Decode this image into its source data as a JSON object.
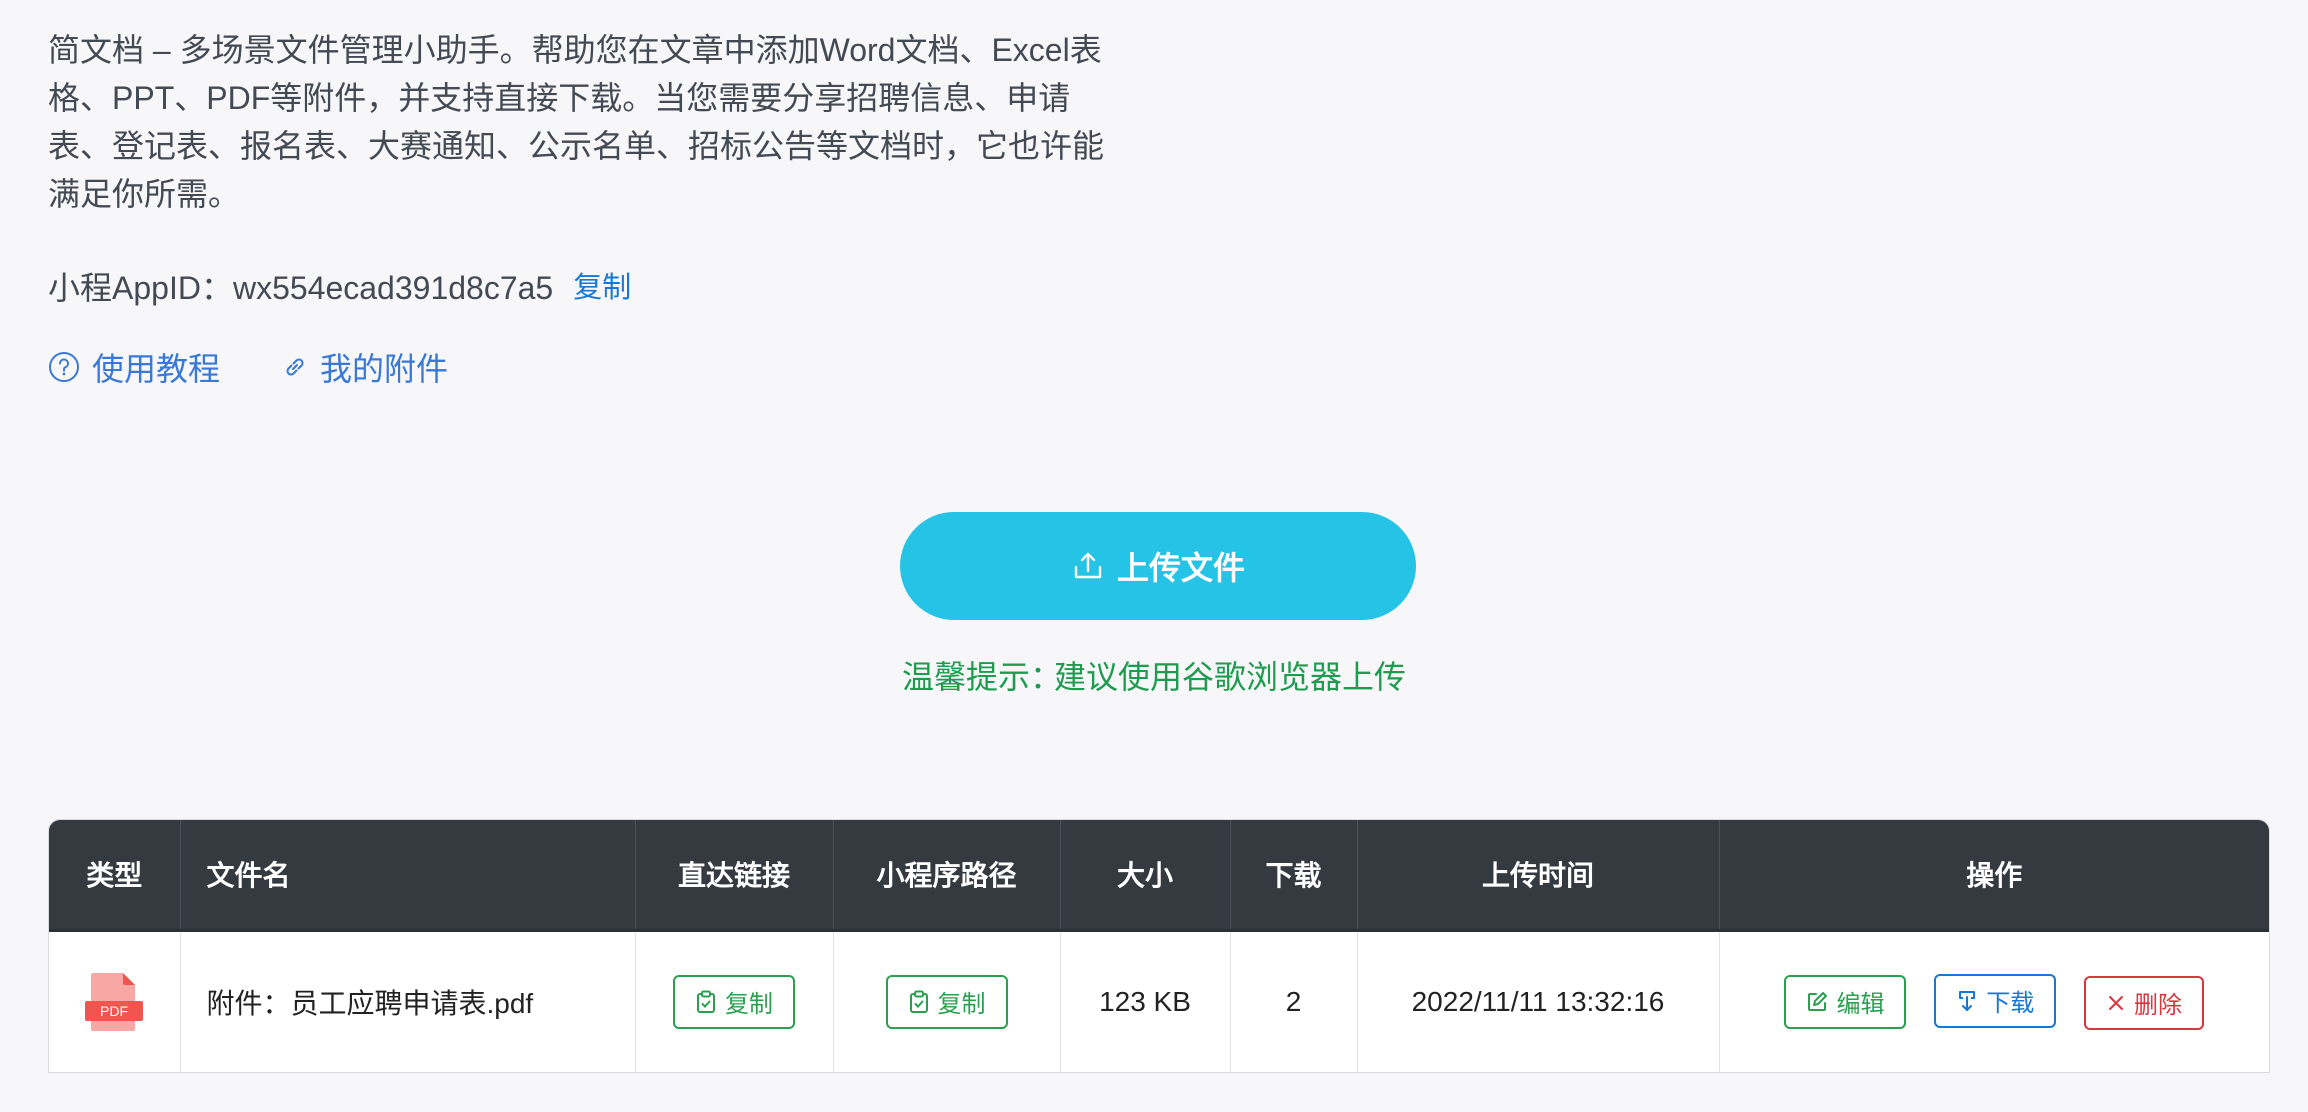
{
  "description": {
    "line1": "简文档 – 多场景文件管理小助手。帮助您在文章中添加Word文档、Excel表",
    "line2": "格、PPT、PDF等附件，并支持直接下载。当您需要分享招聘信息、申请",
    "line3": "表、登记表、报名表、大赛通知、公示名单、招标公告等文档时，它也许能",
    "line4": "满足你所需。"
  },
  "appid": {
    "label": "小程AppID：",
    "value": "wx554ecad391d8c7a5",
    "copy_label": "复制"
  },
  "links": {
    "tutorial": "使用教程",
    "my_attachments": "我的附件"
  },
  "upload": {
    "button_label": "上传文件",
    "tip_prefix": "温馨提示：",
    "tip_text": "建议使用谷歌浏览器上传"
  },
  "table": {
    "headers": {
      "type": "类型",
      "filename": "文件名",
      "direct_link": "直达链接",
      "mp_path": "小程序路径",
      "size": "大小",
      "downloads": "下载",
      "upload_time": "上传时间",
      "actions": "操作"
    },
    "rows": [
      {
        "type_icon_label": "PDF",
        "filename": "附件：员工应聘申请表.pdf",
        "direct_link_btn": "复制",
        "mp_path_btn": "复制",
        "size": "123 KB",
        "downloads": "2",
        "upload_time": "2022/11/11 13:32:16",
        "edit_btn": "编辑",
        "download_btn": "下载",
        "delete_btn": "删除"
      }
    ]
  },
  "colors": {
    "primary_button": "#25c3e6",
    "tip_green": "#1e9b4e",
    "link_blue": "#3a78d8",
    "header_dark": "#343a40",
    "pdf_red": "#f0564f"
  }
}
